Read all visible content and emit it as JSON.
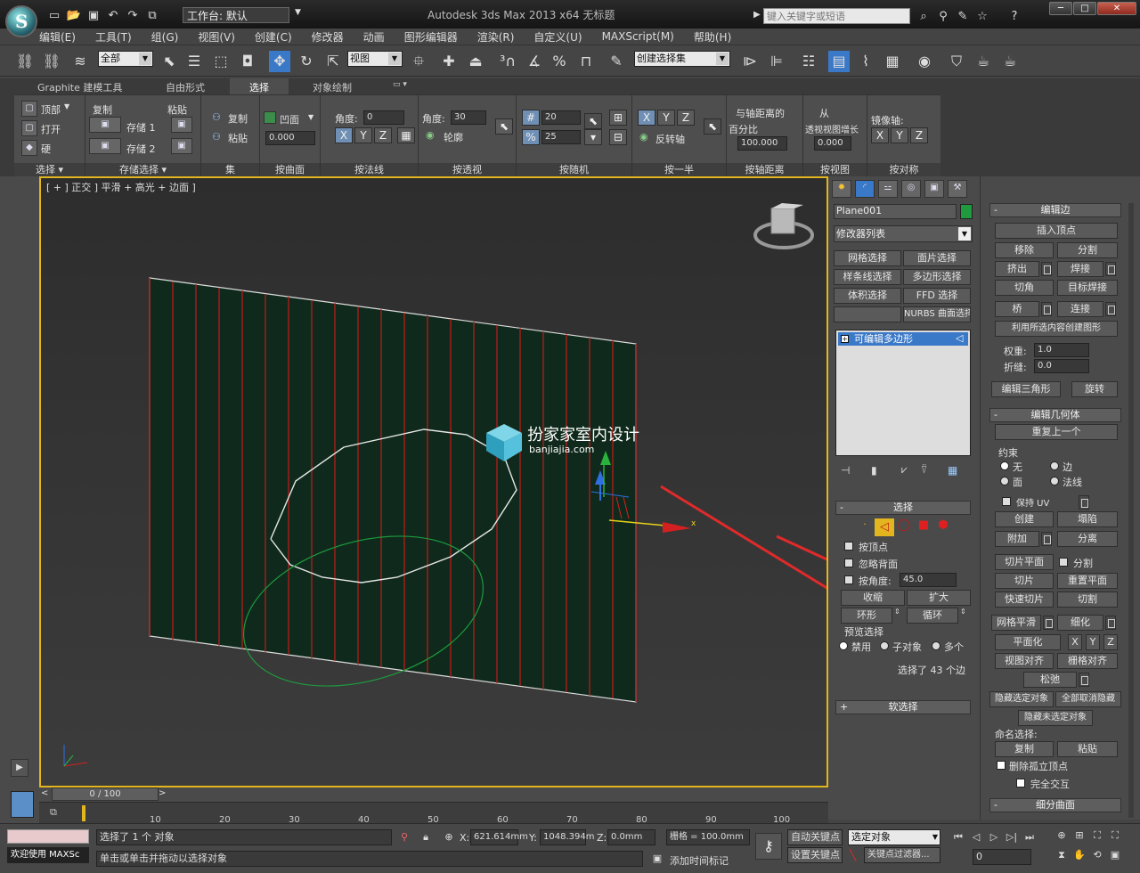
{
  "titlebar": {
    "workspace": "工作台: 默认",
    "title": "Autodesk 3ds Max  2013 x64        无标题",
    "search_placeholder": "键入关键字或短语",
    "logo": "S"
  },
  "menu": [
    "编辑(E)",
    "工具(T)",
    "组(G)",
    "视图(V)",
    "创建(C)",
    "修改器",
    "动画",
    "图形编辑器",
    "渲染(R)",
    "自定义(U)",
    "MAXScript(M)",
    "帮助(H)"
  ],
  "toolbar": {
    "filter": "全部",
    "coord": "视图",
    "selection_set": "创建选择集"
  },
  "ribbon": {
    "tabs": [
      "Graphite 建模工具",
      "自由形式",
      "选择",
      "对象绘制"
    ],
    "active_tab": "选择",
    "groups": {
      "select": {
        "label": "选择",
        "top": "顶部",
        "open": "打开",
        "hard": "硬"
      },
      "store": {
        "label": "存储选择",
        "copy": "复制",
        "paste": "粘贴",
        "store1": "存储 1",
        "store2": "存储 2"
      },
      "set": {
        "label": "集",
        "copy": "复制",
        "paste": "粘贴"
      },
      "by_surface": {
        "label": "按曲面",
        "concave": "凹面",
        "value": "0.000"
      },
      "by_normal": {
        "label": "按法线",
        "angle_label": "角度:",
        "angle": "0",
        "x": "X",
        "y": "Y",
        "z": "Z"
      },
      "by_perspective": {
        "label": "按透视",
        "angle_label": "角度:",
        "angle": "30",
        "outline": "轮廓"
      },
      "by_random": {
        "label": "按随机",
        "v1": "20",
        "v2": "25"
      },
      "by_half": {
        "label": "按一半",
        "x": "X",
        "y": "Y",
        "z": "Z",
        "invert": "反转轴"
      },
      "by_pivot_distance": {
        "label": "按轴距离",
        "line1": "与轴距离的",
        "line2": "百分比",
        "value": "100.000"
      },
      "by_view": {
        "label": "按视图",
        "line1": "从",
        "line2": "透视视图增长",
        "value": "0.000"
      },
      "by_symmetry": {
        "label": "按对称",
        "mirror": "镜像轴:",
        "x": "X",
        "y": "Y",
        "z": "Z"
      }
    }
  },
  "viewport": {
    "label": "[ + ] 正交 ] 平滑 + 高光 + 边面 ]",
    "watermark_name": "扮家家室内设计",
    "watermark_url": "banjiajia.com",
    "axis_x": "x"
  },
  "command_panel": {
    "object_name": "Plane001",
    "modifier_list": "修改器列表",
    "buttons": [
      "网格选择",
      "面片选择",
      "样条线选择",
      "多边形选择",
      "体积选择",
      "FFD 选择",
      "",
      "NURBS 曲面选择"
    ],
    "stack_item": "可编辑多边形",
    "selection": {
      "title": "选择",
      "by_vertex": "按顶点",
      "ignore_back": "忽略背面",
      "angle_label": "按角度:",
      "angle": "45.0",
      "shrink": "收缩",
      "grow": "扩大",
      "ring": "环形",
      "loop": "循环",
      "preview_title": "预览选择",
      "disable": "禁用",
      "subobject": "子对象",
      "multi": "多个",
      "status": "选择了 43 个边"
    },
    "soft_selection": "软选择"
  },
  "edit_edges": {
    "title": "编辑边",
    "insert_vertex": "插入顶点",
    "remove": "移除",
    "split": "分割",
    "extrude": "挤出",
    "weld": "焊接",
    "chamfer": "切角",
    "target_weld": "目标焊接",
    "bridge": "桥",
    "connect": "连接",
    "create_shape": "利用所选内容创建图形",
    "weight_label": "权重:",
    "weight": "1.0",
    "crease_label": "折缝:",
    "crease": "0.0",
    "edit_tri": "编辑三角形",
    "turn": "旋转"
  },
  "edit_geometry": {
    "title": "编辑几何体",
    "repeat_last": "重复上一个",
    "constraints": "约束",
    "none": "无",
    "edge": "边",
    "face": "面",
    "normal": "法线",
    "preserve_uv": "保持 UV",
    "create": "创建",
    "collapse": "塌陷",
    "attach": "附加",
    "detach": "分离",
    "slice_plane": "切片平面",
    "split": "分割",
    "slice": "切片",
    "reset_plane": "重置平面",
    "quickslice": "快速切片",
    "cut": "切割",
    "meshsmooth": "网格平滑",
    "tessellate": "细化",
    "make_planar": "平面化",
    "x": "X",
    "y": "Y",
    "z": "Z",
    "view_align": "视图对齐",
    "grid_align": "栅格对齐",
    "relax": "松弛",
    "hide_selected": "隐藏选定对象",
    "unhide_all": "全部取消隐藏",
    "hide_unselected": "隐藏未选定对象",
    "named_sel": "命名选择:",
    "copy": "复制",
    "paste": "粘贴",
    "delete_isolated": "删除孤立顶点",
    "full_interact": "完全交互",
    "subdivision": "细分曲面"
  },
  "timeline": {
    "slider": "0 / 100",
    "ticks": [
      "10",
      "20",
      "30",
      "40",
      "50",
      "60",
      "70",
      "80",
      "90",
      "100"
    ]
  },
  "status": {
    "welcome": "欢迎使用 MAXSc",
    "selected": "选择了 1 个 对象",
    "hint": "单击或单击并拖动以选择对象",
    "x_label": "X:",
    "x": "621.614mm",
    "y_label": "Y:",
    "y": "1048.394m",
    "z_label": "Z:",
    "z": "0.0mm",
    "grid": "栅格 = 100.0mm",
    "add_time_tag": "添加时间标记",
    "auto_key": "自动关键点",
    "set_key": "设置关键点",
    "selected_obj": "选定对象",
    "key_filters": "关键点过滤器...",
    "frame": "0"
  },
  "colors": {
    "plane": "#0f2a1c",
    "edge_red": "#c41a1a",
    "viewport_border": "#e3b51e",
    "arrow_red": "#e02a2a",
    "accent_blue": "#3a78c8"
  }
}
